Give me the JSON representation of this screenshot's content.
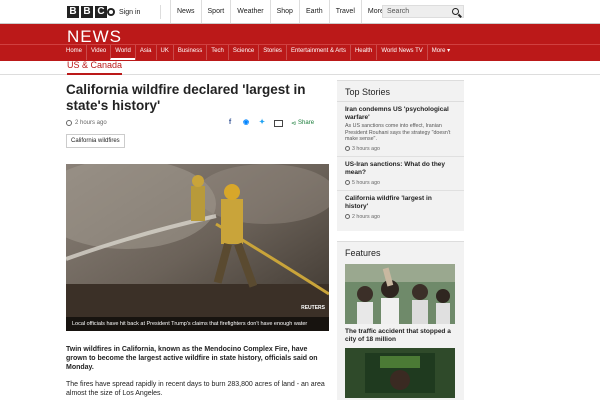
{
  "topbar": {
    "logo_letters": [
      "B",
      "B",
      "C"
    ],
    "signin": "Sign in",
    "nav": [
      "News",
      "Sport",
      "Weather",
      "Shop",
      "Earth",
      "Travel"
    ],
    "more": "More",
    "more_chevron": "▾",
    "search_placeholder": "Search"
  },
  "newsbar": {
    "title": "NEWS",
    "nav": [
      "Home",
      "Video",
      "World",
      "Asia",
      "UK",
      "Business",
      "Tech",
      "Science",
      "Stories",
      "Entertainment & Arts",
      "Health",
      "World News TV",
      "More ▾"
    ],
    "active": "World"
  },
  "section": "US & Canada",
  "article": {
    "headline": "California wildfire declared 'largest in state's history'",
    "time": "2 hours ago",
    "share_label": "Share",
    "tag": "California wildfires",
    "photo_credit": "REUTERS",
    "caption": "Local officials have hit back at President Trump's claims that firefighters don't have enough water",
    "p1": "Twin wildfires in California, known as the Mendocino Complex Fire, have grown to become the largest active wildfire in state history, officials said on Monday.",
    "p2": "The fires have spread rapidly in recent days to burn 283,800 acres of land - an area almost the size of Los Angeles."
  },
  "top_stories": {
    "title": "Top Stories",
    "items": [
      {
        "headline": "Iran condemns US 'psychological warfare'",
        "summary": "As US sanctions come into effect, Iranian President Rouhani says the strategy \"doesn't make sense\".",
        "time": "3 hours ago"
      },
      {
        "headline": "US-Iran sanctions: What do they mean?",
        "summary": "",
        "time": "5 hours ago"
      },
      {
        "headline": "California wildfire 'largest in history'",
        "summary": "",
        "time": "2 hours ago"
      }
    ]
  },
  "features": {
    "title": "Features",
    "items": [
      {
        "caption": "The traffic accident that stopped a city of 18 million"
      }
    ]
  },
  "colors": {
    "brand_red": "#bb1919",
    "share_green": "#1a7d3a"
  }
}
